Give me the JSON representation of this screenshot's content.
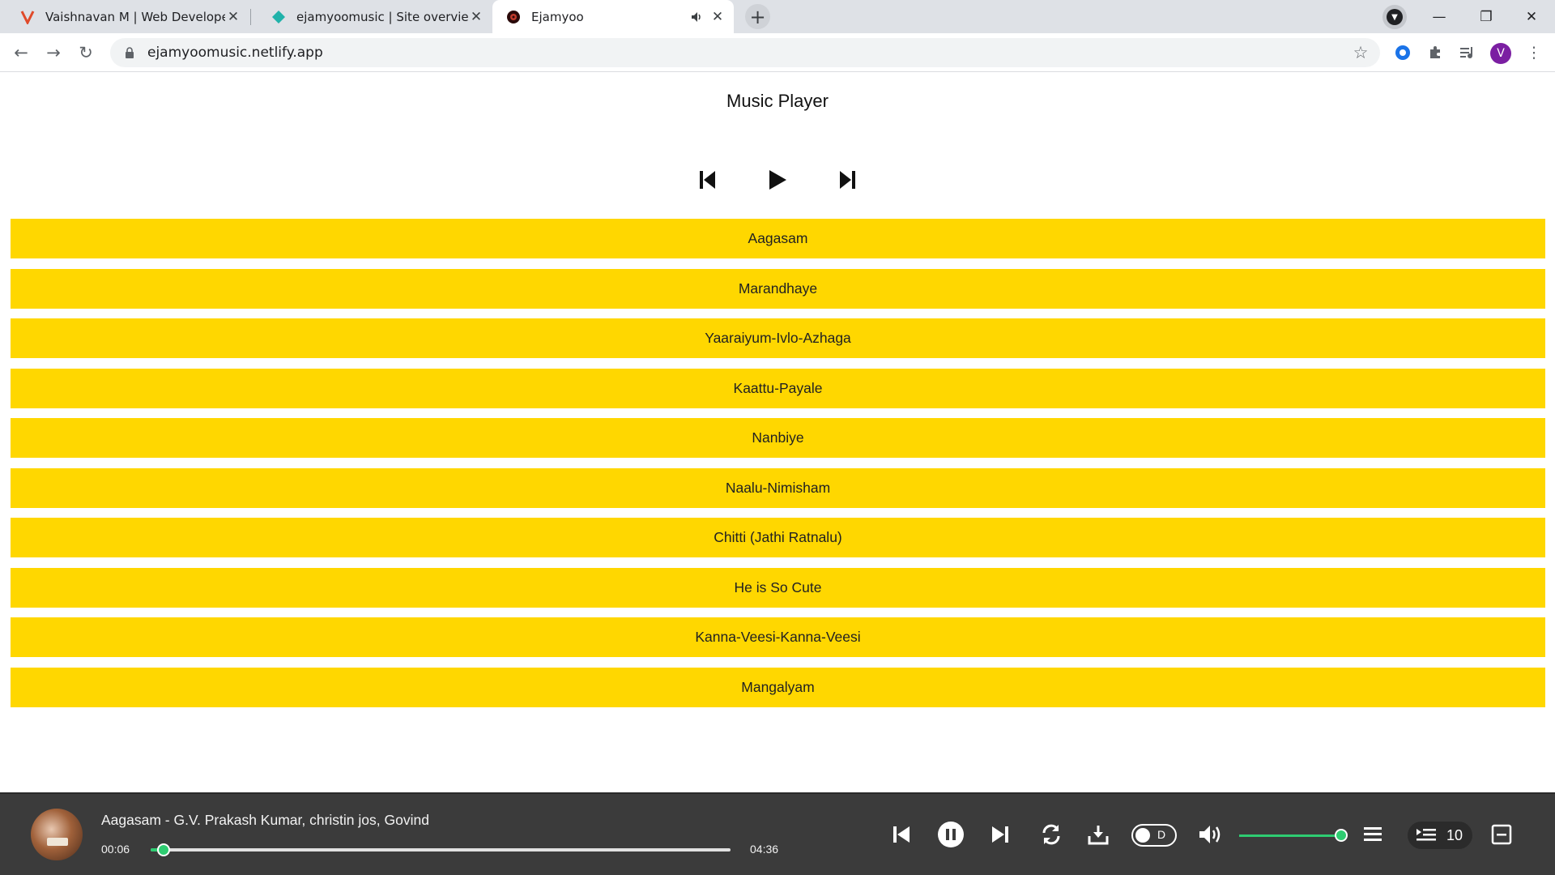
{
  "browser": {
    "tabs": [
      {
        "label": "Vaishnavan M | Web Developer",
        "favicon": "v-logo-icon"
      },
      {
        "label": "ejamyoomusic | Site overview",
        "favicon": "netlify-icon"
      },
      {
        "label": "Ejamyoo",
        "favicon": "record-icon",
        "active": true,
        "audio": true
      }
    ],
    "url": "ejamyoomusic.netlify.app",
    "avatar_letter": "V"
  },
  "page": {
    "title": "Music Player",
    "songs": [
      "Aagasam",
      "Marandhaye",
      "Yaaraiyum-Ivlo-Azhaga",
      "Kaattu-Payale",
      "Nanbiye",
      "Naalu-Nimisham",
      "Chitti (Jathi Ratnalu)",
      "He is So Cute",
      "Kanna-Veesi-Kanna-Veesi",
      "Mangalyam"
    ]
  },
  "player": {
    "now_playing": "Aagasam - G.V. Prakash Kumar, christin jos, Govind",
    "current_time": "00:06",
    "duration": "04:36",
    "progress": 0.023,
    "toggle_label": "D",
    "volume": 1.0,
    "queue_count": "10",
    "accent": "#2ecc71",
    "bg": "#3b3b3b"
  },
  "colors": {
    "song_bg": "#ffd700"
  }
}
